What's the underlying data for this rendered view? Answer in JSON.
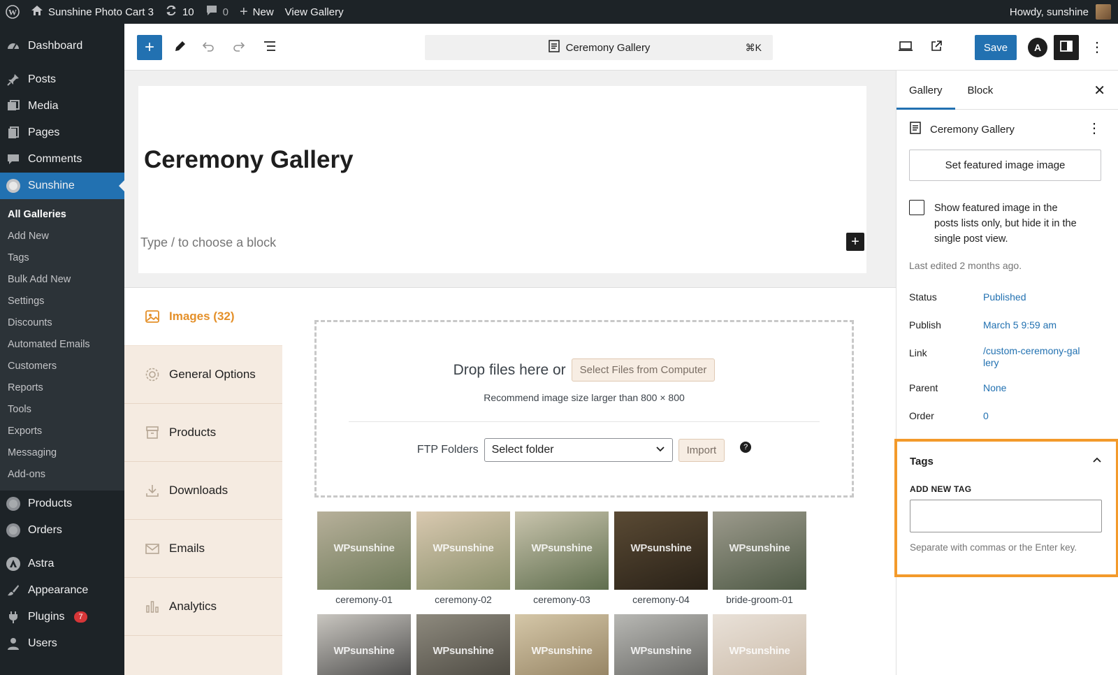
{
  "admin_bar": {
    "site_name": "Sunshine Photo Cart 3",
    "updates_count": "10",
    "comments_count": "0",
    "new_label": "New",
    "view_label": "View Gallery",
    "howdy": "Howdy, sunshine"
  },
  "sidebar": {
    "top_items": [
      {
        "label": "Dashboard",
        "icon": "dashboard-icon"
      },
      {
        "label": "Posts",
        "icon": "pin-icon"
      },
      {
        "label": "Media",
        "icon": "media-icon"
      },
      {
        "label": "Pages",
        "icon": "pages-icon"
      },
      {
        "label": "Comments",
        "icon": "comments-icon"
      },
      {
        "label": "Sunshine",
        "icon": "sunshine-icon"
      }
    ],
    "sub_items": [
      "All Galleries",
      "Add New",
      "Tags",
      "Bulk Add New",
      "Settings",
      "Discounts",
      "Automated Emails",
      "Customers",
      "Reports",
      "Tools",
      "Exports",
      "Messaging",
      "Add-ons"
    ],
    "bottom_items": [
      {
        "label": "Products",
        "icon": "products-icon"
      },
      {
        "label": "Orders",
        "icon": "orders-icon"
      },
      {
        "label": "Astra",
        "icon": "astra-icon"
      },
      {
        "label": "Appearance",
        "icon": "brush-icon"
      },
      {
        "label": "Plugins",
        "icon": "plugin-icon",
        "badge": "7"
      },
      {
        "label": "Users",
        "icon": "users-icon"
      }
    ]
  },
  "toolbar": {
    "command_title": "Ceremony Gallery",
    "shortcut": "⌘K",
    "save_label": "Save",
    "astra_letter": "A"
  },
  "editor": {
    "title": "Ceremony Gallery",
    "block_placeholder": "Type / to choose a block"
  },
  "gallery": {
    "tabs": [
      {
        "label": "Images (32)",
        "icon": "image-icon"
      },
      {
        "label": "General Options",
        "icon": "gear-icon"
      },
      {
        "label": "Products",
        "icon": "box-icon"
      },
      {
        "label": "Downloads",
        "icon": "download-icon"
      },
      {
        "label": "Emails",
        "icon": "mail-icon"
      },
      {
        "label": "Analytics",
        "icon": "analytics-icon"
      }
    ],
    "drop_text": "Drop files here or",
    "select_files_label": "Select Files from Computer",
    "recommend": "Recommend image size larger than 800 × 800",
    "ftp_label": "FTP Folders",
    "folder_value": "Select folder",
    "import_label": "Import",
    "watermark": "WPsunshine",
    "thumbnails": [
      {
        "name": "ceremony-01",
        "colors": [
          "#b7b09a",
          "#6f7a5a"
        ]
      },
      {
        "name": "ceremony-02",
        "colors": [
          "#d9c9b0",
          "#8a8f6c"
        ]
      },
      {
        "name": "ceremony-03",
        "colors": [
          "#c9c4ad",
          "#5f6e4e"
        ]
      },
      {
        "name": "ceremony-04",
        "colors": [
          "#5a4a34",
          "#2a2218"
        ]
      },
      {
        "name": "bride-groom-01",
        "colors": [
          "#9c9a8c",
          "#4f5a46"
        ]
      },
      {
        "name": "",
        "colors": [
          "#c9c6c0",
          "#3b3b3b"
        ]
      },
      {
        "name": "",
        "colors": [
          "#8e8a7e",
          "#44413a"
        ]
      },
      {
        "name": "",
        "colors": [
          "#d5c7a8",
          "#8c7a5a"
        ]
      },
      {
        "name": "",
        "colors": [
          "#b8b8b4",
          "#5b5b58"
        ]
      },
      {
        "name": "",
        "colors": [
          "#e9e1d8",
          "#c7b6a3"
        ]
      }
    ]
  },
  "settings": {
    "tab_gallery": "Gallery",
    "tab_block": "Block",
    "doc_title": "Ceremony Gallery",
    "featured_button": "Set featured image image",
    "featured_checkbox_text": "Show featured image in the posts lists only, but hide it in the single post view.",
    "last_edited": "Last edited 2 months ago.",
    "rows": [
      {
        "key": "Status",
        "value": "Published"
      },
      {
        "key": "Publish",
        "value": "March 5 9:59 am"
      },
      {
        "key": "Link",
        "value": "/custom-ceremony-gallery"
      },
      {
        "key": "Parent",
        "value": "None"
      },
      {
        "key": "Order",
        "value": "0"
      }
    ],
    "tags_title": "Tags",
    "add_new_tag": "ADD NEW TAG",
    "tag_input_value": "",
    "tag_help": "Separate with commas or the Enter key."
  },
  "colors": {
    "admin_dark": "#1d2327",
    "accent": "#2271b1",
    "orange": "#f39a2b",
    "gallery_tab_bg": "#f5ebe1"
  }
}
